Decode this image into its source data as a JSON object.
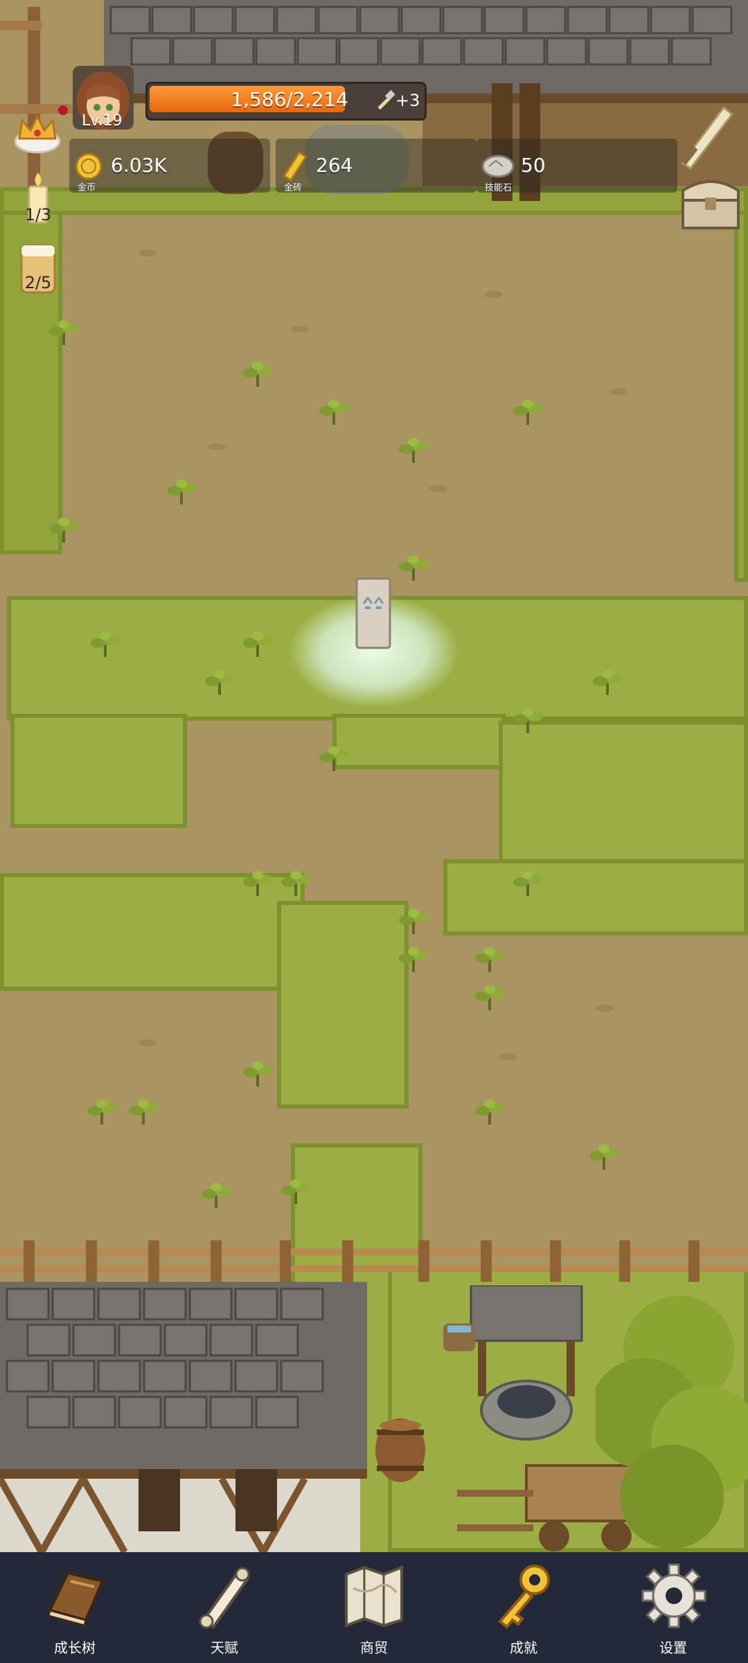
{
  "player": {
    "level": "Lv.19",
    "exp_text": "1,586/2,214",
    "exp_fraction": 0.716,
    "exp_bonus": "+3"
  },
  "resources": {
    "gold": {
      "value": "6.03K",
      "caption": "金币"
    },
    "gold_brick": {
      "value": "264",
      "caption": "金砖"
    },
    "skill_stone": {
      "value": "50",
      "caption": "技能石"
    }
  },
  "side_counters": {
    "candle": "1/3",
    "drink": "2/5"
  },
  "nav": [
    {
      "label": "成长树",
      "icon": "book-icon"
    },
    {
      "label": "天赋",
      "icon": "scroll-icon"
    },
    {
      "label": "商贸",
      "icon": "map-icon"
    },
    {
      "label": "成就",
      "icon": "key-icon"
    },
    {
      "label": "设置",
      "icon": "gear-icon"
    }
  ],
  "colors": {
    "exp_bar": "#f07a1a",
    "nav_bg": "#24293a",
    "grass": "#93a43a",
    "dirt": "#aa9562"
  }
}
